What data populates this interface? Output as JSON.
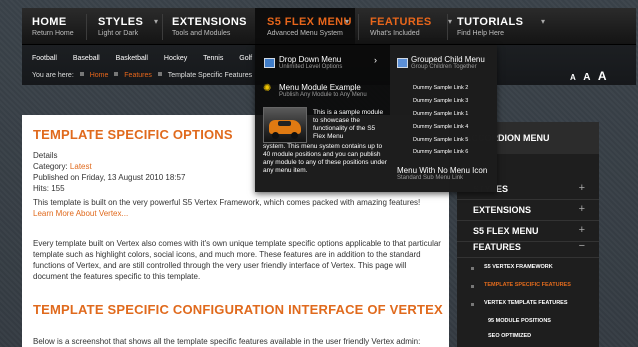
{
  "nav": {
    "items": [
      {
        "title": "HOME",
        "subtitle": "Return Home"
      },
      {
        "title": "STYLES",
        "subtitle": "Light or Dark"
      },
      {
        "title": "EXTENSIONS",
        "subtitle": "Tools and Modules"
      },
      {
        "title": "S5 FLEX MENU",
        "subtitle": "Advanced Menu System"
      },
      {
        "title": "FEATURES",
        "subtitle": "What's Included"
      },
      {
        "title": "TUTORIALS",
        "subtitle": "Find Help Here"
      }
    ]
  },
  "subnav": {
    "categories": [
      "Football",
      "Baseball",
      "Basketball",
      "Hockey",
      "Tennis",
      "Golf"
    ],
    "breadcrumb": {
      "prefix": "You are here:",
      "home": "Home",
      "features": "Features",
      "current": "Template Specific Features"
    },
    "font_sizes": [
      "A",
      "A",
      "A"
    ]
  },
  "dropdown": {
    "col1": {
      "item1": {
        "title": "Drop Down Menu",
        "subtitle": "Unlimited Level Options"
      },
      "item2": {
        "title": "Menu Module Example",
        "subtitle": "Publish Any Module to Any Menu"
      },
      "module_text_top": "This is a sample module to showcase the functionality of the S5 Flex Menu",
      "module_text_bottom": "system. This menu system contains up to 40 module positions and you can publish any module to any of these positions under any menu item.",
      "arrow": "›"
    },
    "col2": {
      "grouped": {
        "title": "Grouped Child Menu",
        "subtitle": "Group Children Together"
      },
      "links": [
        "Dummy Sample Link 2",
        "Dummy Sample Link 3",
        "Dummy Sample Link 1",
        "Dummy Sample Link 4",
        "Dummy Sample Link 5",
        "Dummy Sample Link 6"
      ],
      "no_icon": {
        "title": "Menu With No Menu Icon",
        "subtitle": "Standard Sub Menu Link"
      }
    }
  },
  "article": {
    "title": "TEMPLATE SPECIFIC OPTIONS",
    "details_label": "Details",
    "category_label": "Category:",
    "category_value": "Latest",
    "published": "Published on Friday, 13 August 2010 18:57",
    "hits": "Hits: 155",
    "para1": "This template is built on the very powerful S5 Vertex Framework, which comes packed with amazing features!",
    "learn_more": "Learn More About Vertex...",
    "para2": "Every template built on Vertex also comes with it's own unique template specific options applicable to that particular template such as highlight colors, social icons, and much more. These features are in addition to the standard functions of Vertex, and are still controlled through the very user friendly interface of Vertex. This page will document the features specific to this template.",
    "subtitle": "TEMPLATE SPECIFIC CONFIGURATION INTERFACE OF VERTEX",
    "para3": "Below is a screenshot that shows all the template specific features available in the user friendly Vertex admin:"
  },
  "sidebar": {
    "title": "ACCORDION MENU",
    "rows": [
      {
        "label": "STYLES",
        "toggle": "+"
      },
      {
        "label": "EXTENSIONS",
        "toggle": "+"
      },
      {
        "label": "S5 FLEX MENU",
        "toggle": "+"
      },
      {
        "label": "FEATURES",
        "toggle": "−"
      }
    ],
    "subitems": [
      "S5 VERTEX FRAMEWORK",
      "TEMPLATE SPECIFIC FEATURES",
      "VERTEX TEMPLATE FEATURES",
      "95 MODULE POSITIONS",
      "SEO OPTIMIZED"
    ]
  },
  "colors": {
    "accent": "#e06a1d",
    "nav_bg": "#1b1b1b",
    "sidebar_bg": "#1e1e1e"
  },
  "icons": {
    "chevron": "chevron-down-icon",
    "menu": "menu-icon",
    "star": "star-icon",
    "group": "group-icon",
    "bullet": "square-bullet-icon"
  }
}
